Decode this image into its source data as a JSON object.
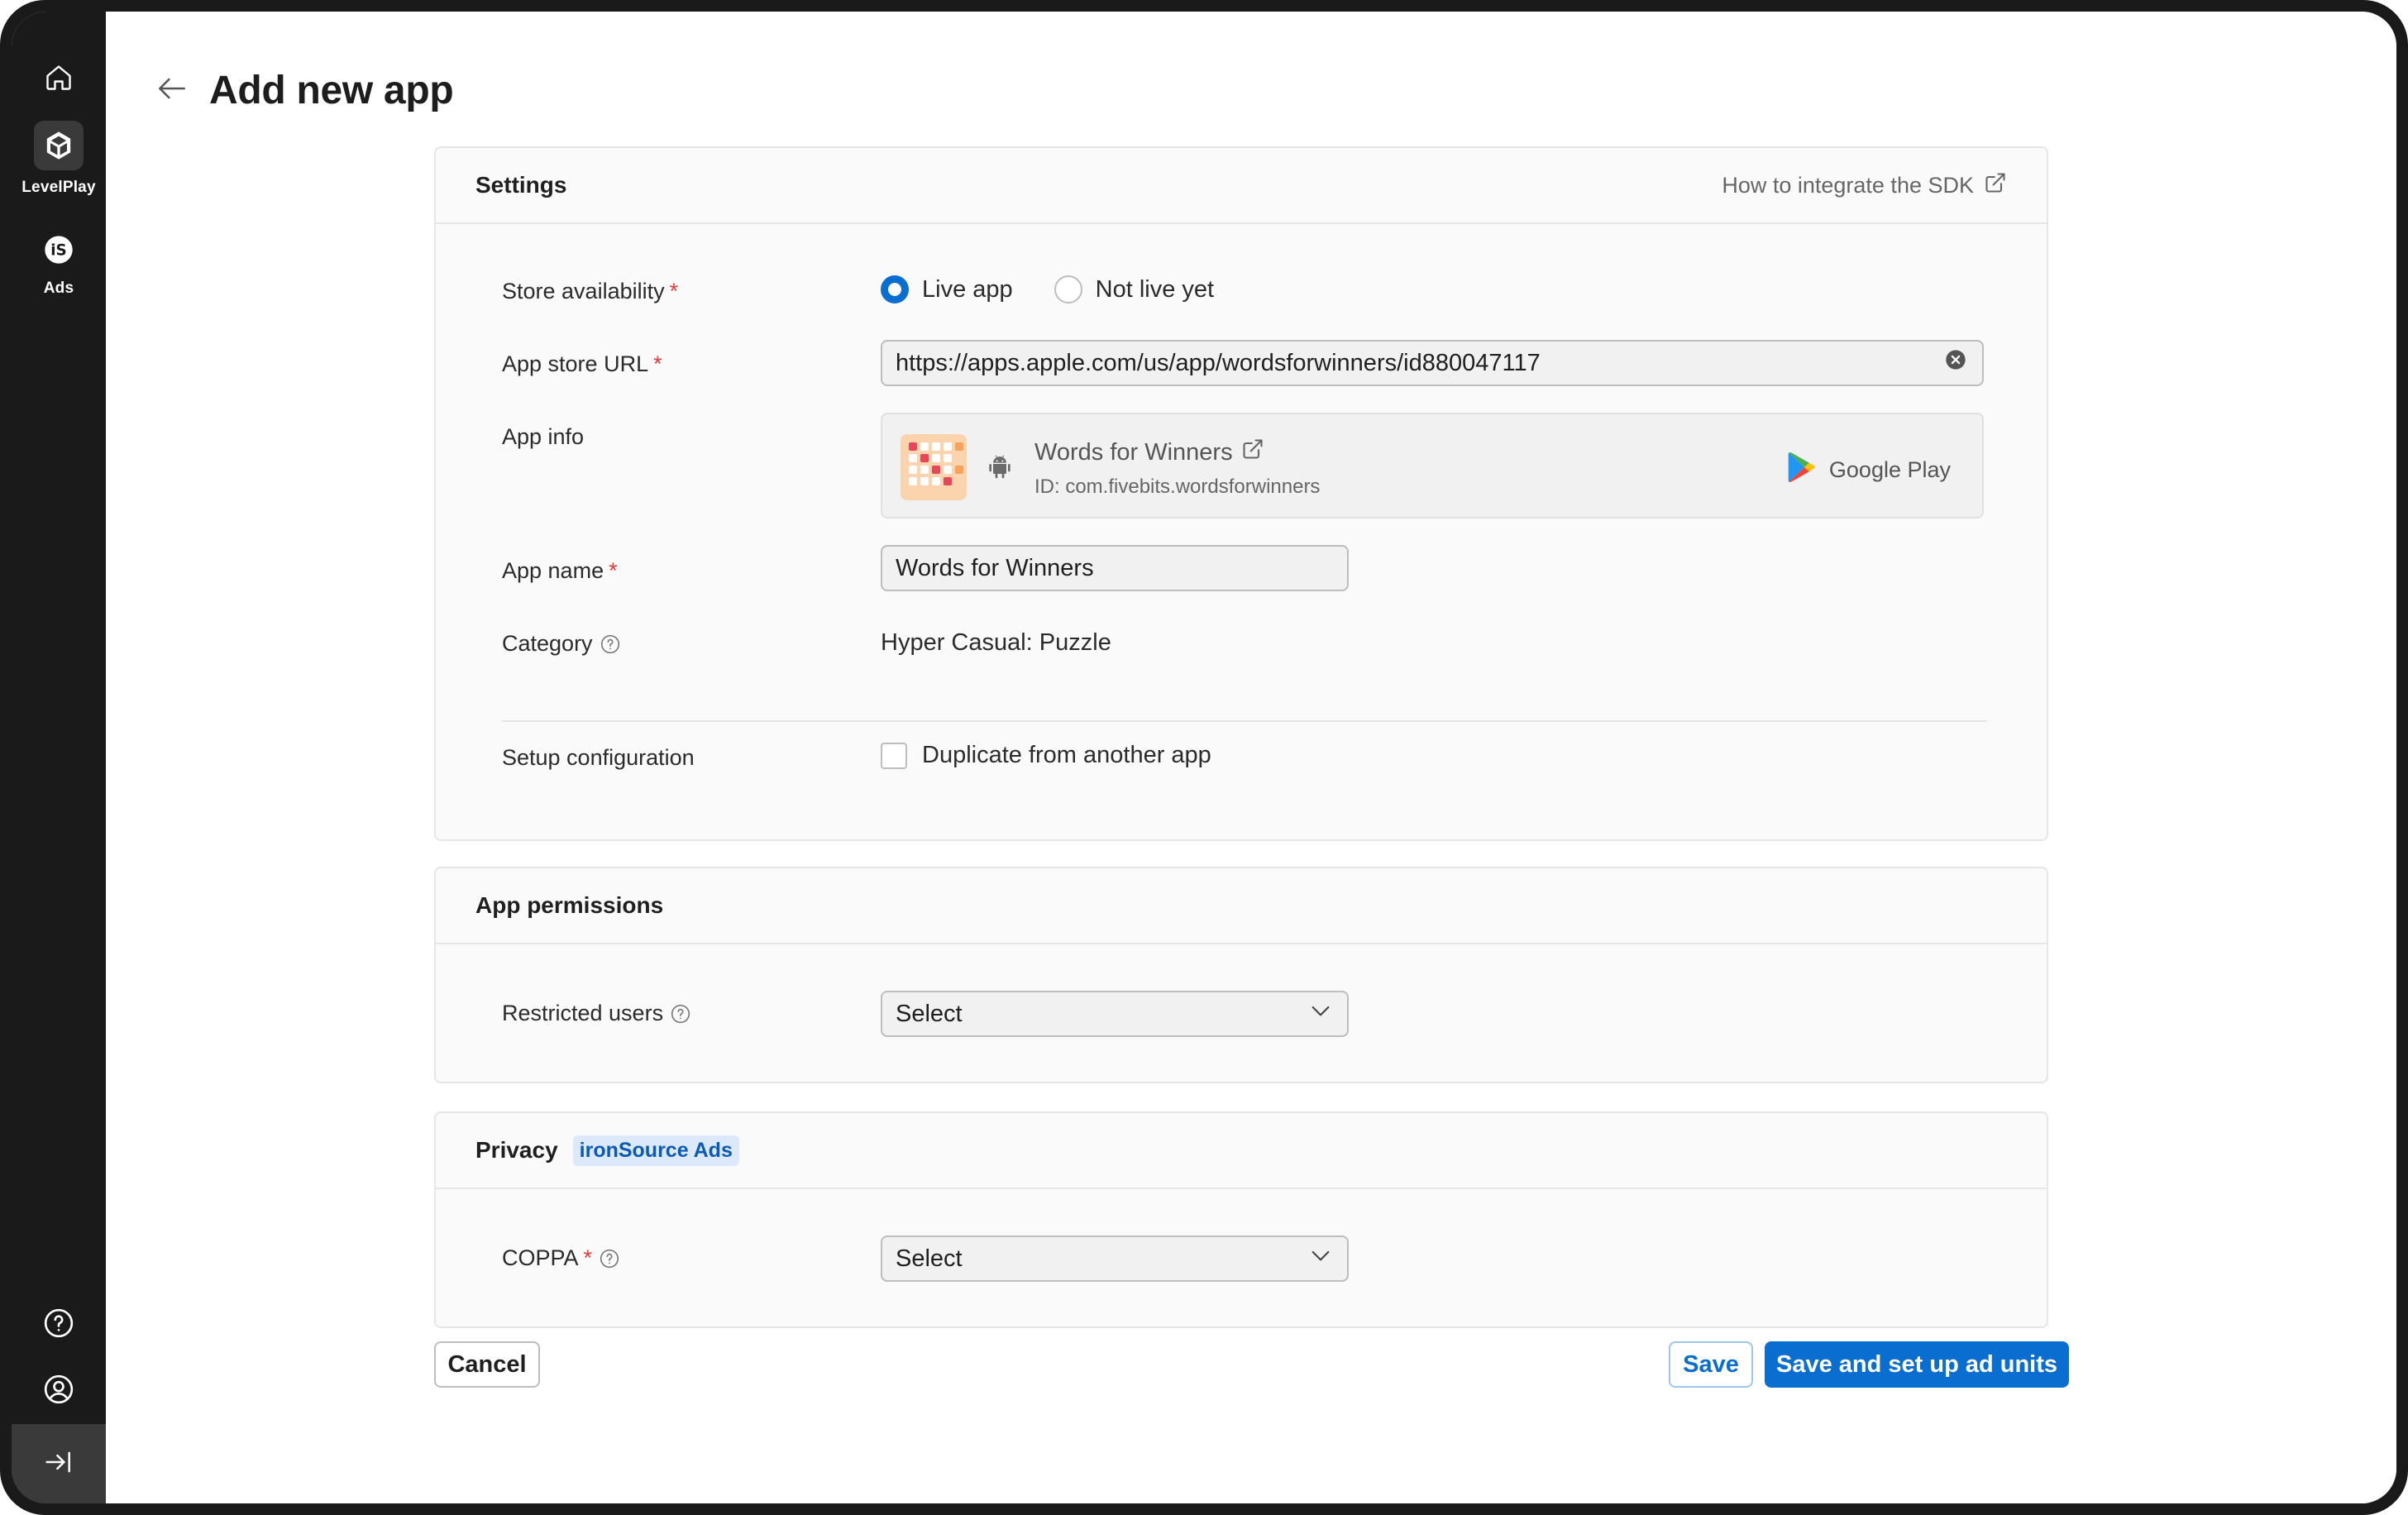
{
  "sidebar": {
    "items": [
      {
        "label": "",
        "icon": "home-icon"
      },
      {
        "label": "LevelPlay",
        "icon": "unity-icon"
      },
      {
        "label": "Ads",
        "icon": "ironsource-icon"
      }
    ],
    "bottom": [
      {
        "icon": "help-icon"
      },
      {
        "icon": "account-icon"
      },
      {
        "icon": "expand-sidebar-icon"
      }
    ]
  },
  "header": {
    "title": "Add new app"
  },
  "settings": {
    "title": "Settings",
    "sdk_link": "How to integrate the SDK",
    "store_availability": {
      "label": "Store availability",
      "required": "*",
      "options": [
        "Live app",
        "Not live yet"
      ],
      "selected": "Live app"
    },
    "app_store_url": {
      "label": "App store URL",
      "required": "*",
      "value": "https://apps.apple.com/us/app/wordsforwinners/id880047117"
    },
    "app_info": {
      "label": "App info",
      "app_title": "Words for Winners",
      "app_id": "ID: com.fivebits.wordsforwinners",
      "store": "Google Play"
    },
    "app_name": {
      "label": "App name",
      "required": "*",
      "value": "Words for Winners"
    },
    "category": {
      "label": "Category",
      "value": "Hyper Casual: Puzzle"
    },
    "setup_configuration": {
      "label": "Setup configuration",
      "checkbox_label": "Duplicate from another app",
      "checked": false
    }
  },
  "permissions": {
    "title": "App permissions",
    "restricted_users": {
      "label": "Restricted users",
      "value": "Select"
    }
  },
  "privacy": {
    "title": "Privacy",
    "badge": "ironSource Ads",
    "coppa": {
      "label": "COPPA",
      "required": "*",
      "value": "Select"
    }
  },
  "actions": {
    "cancel": "Cancel",
    "save": "Save",
    "save_and_setup": "Save and set up ad units"
  },
  "colors": {
    "accent": "#0a6ed1",
    "required": "#e53935",
    "sidebar": "#1a1a1a"
  }
}
